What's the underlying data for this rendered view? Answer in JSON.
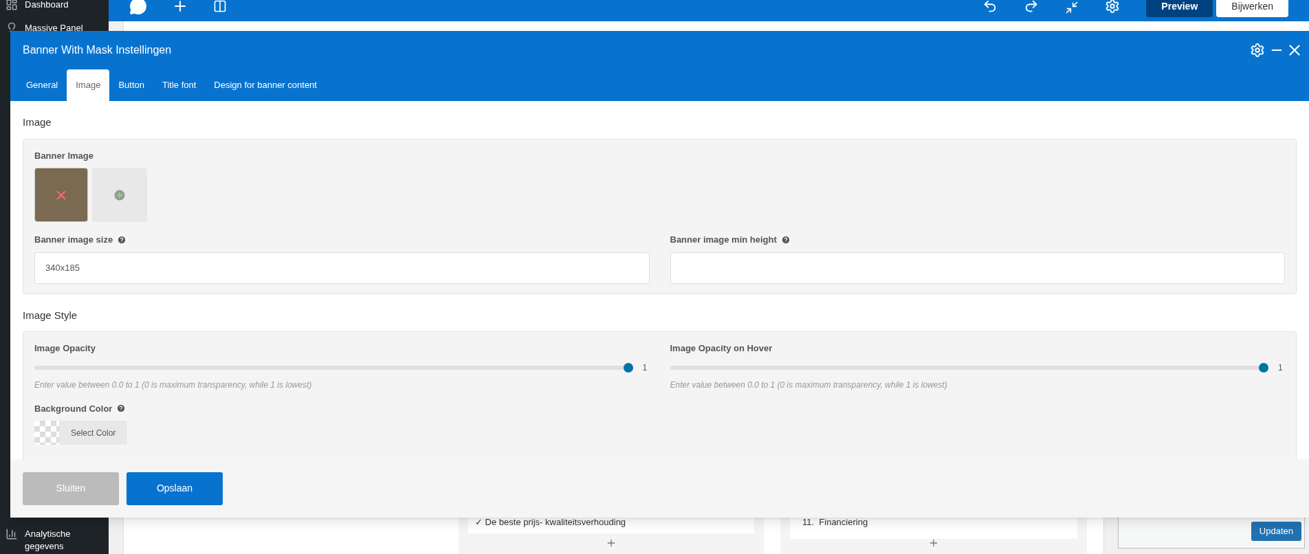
{
  "sidebar": {
    "items": [
      {
        "label": "Dashboard",
        "kind": "dashboard"
      },
      {
        "label": "Massive Panel",
        "kind": "bulb"
      },
      {
        "label": "Analytische gegevens",
        "kind": "chart"
      }
    ]
  },
  "topbar": {
    "buttons": [
      {
        "label": "Preview",
        "kind": "primary"
      },
      {
        "label": "Bijwerken",
        "kind": "secondary"
      }
    ]
  },
  "background": {
    "list_item": "✓ De beste prijs- kwaliteitsverhouding",
    "numbered_item": "11.  Financiering",
    "update_button": "Updaten"
  },
  "modal": {
    "title": "Banner With Mask Instellingen",
    "tabs": [
      {
        "label": "General",
        "selected": false
      },
      {
        "label": "Image",
        "selected": true
      },
      {
        "label": "Button",
        "selected": false
      },
      {
        "label": "Title font",
        "selected": false
      },
      {
        "label": "Design for banner content",
        "selected": false
      }
    ],
    "sections": [
      {
        "heading": "Image",
        "rows": [
          [
            {
              "kind": "image_picker",
              "label": "Banner Image",
              "help": false
            }
          ],
          [
            {
              "kind": "text",
              "label": "Banner image size",
              "help": true,
              "value": "340x185"
            },
            {
              "kind": "text",
              "label": "Banner image min height",
              "help": true
            }
          ]
        ]
      },
      {
        "heading": "Image Style",
        "rows": [
          [
            {
              "kind": "slider",
              "label": "Image Opacity",
              "help": false,
              "level": 1,
              "reading": "1",
              "hint": "Enter value between 0.0 to 1 (0 is maximum transparency, while 1 is lowest)"
            },
            {
              "kind": "slider",
              "label": "Image Opacity on Hover",
              "help": false,
              "level": 1,
              "reading": "1",
              "hint": "Enter value between 0.0 to 1 (0 is maximum transparency, while 1 is lowest)"
            }
          ],
          [
            {
              "kind": "color",
              "label": "Background Color",
              "help": true,
              "button": "Select Color"
            }
          ]
        ]
      }
    ],
    "footer": [
      {
        "label": "Sluiten",
        "kind": "secondary"
      },
      {
        "label": "Opslaan",
        "kind": "primary"
      }
    ]
  }
}
